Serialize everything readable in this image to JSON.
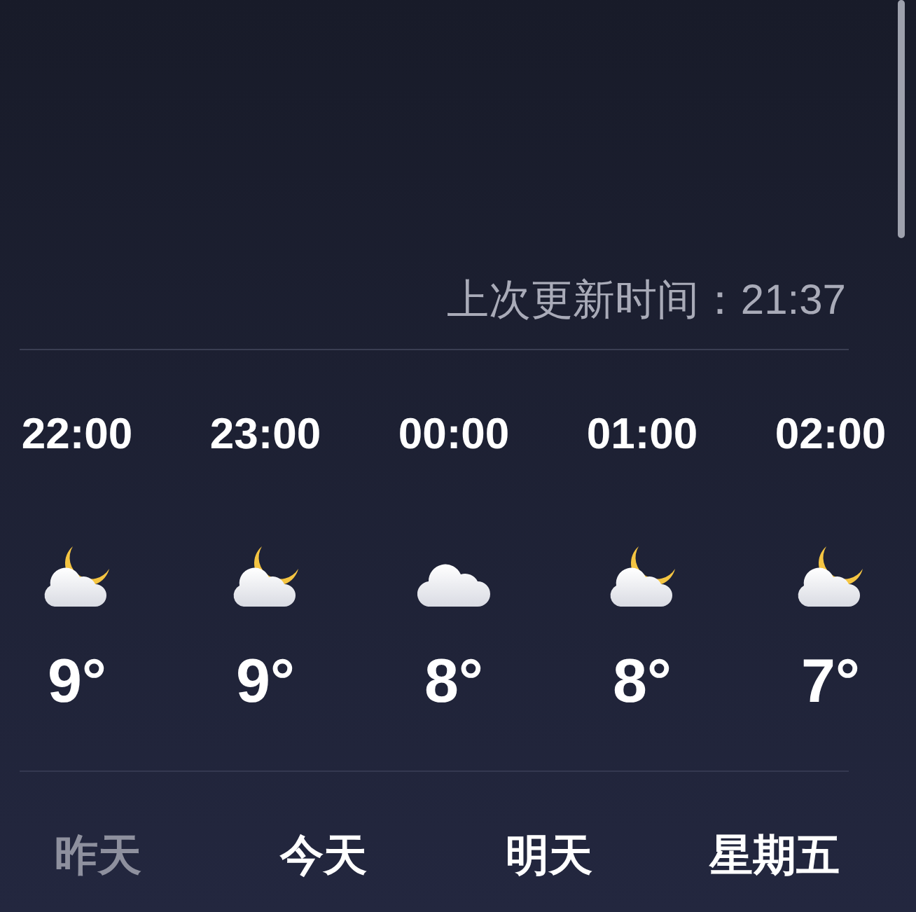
{
  "last_update": "上次更新时间：21:37",
  "hourly": [
    {
      "time": "22:00",
      "kind": "partly-cloudy-night",
      "temp": "9°"
    },
    {
      "time": "23:00",
      "kind": "partly-cloudy-night",
      "temp": "9°"
    },
    {
      "time": "00:00",
      "kind": "cloudy",
      "temp": "8°"
    },
    {
      "time": "01:00",
      "kind": "partly-cloudy-night",
      "temp": "8°"
    },
    {
      "time": "02:00",
      "kind": "partly-cloudy-night",
      "temp": "7°"
    }
  ],
  "days": [
    {
      "label": "昨天",
      "past": true
    },
    {
      "label": "今天",
      "past": false
    },
    {
      "label": "明天",
      "past": false
    },
    {
      "label": "星期五",
      "past": false
    }
  ]
}
